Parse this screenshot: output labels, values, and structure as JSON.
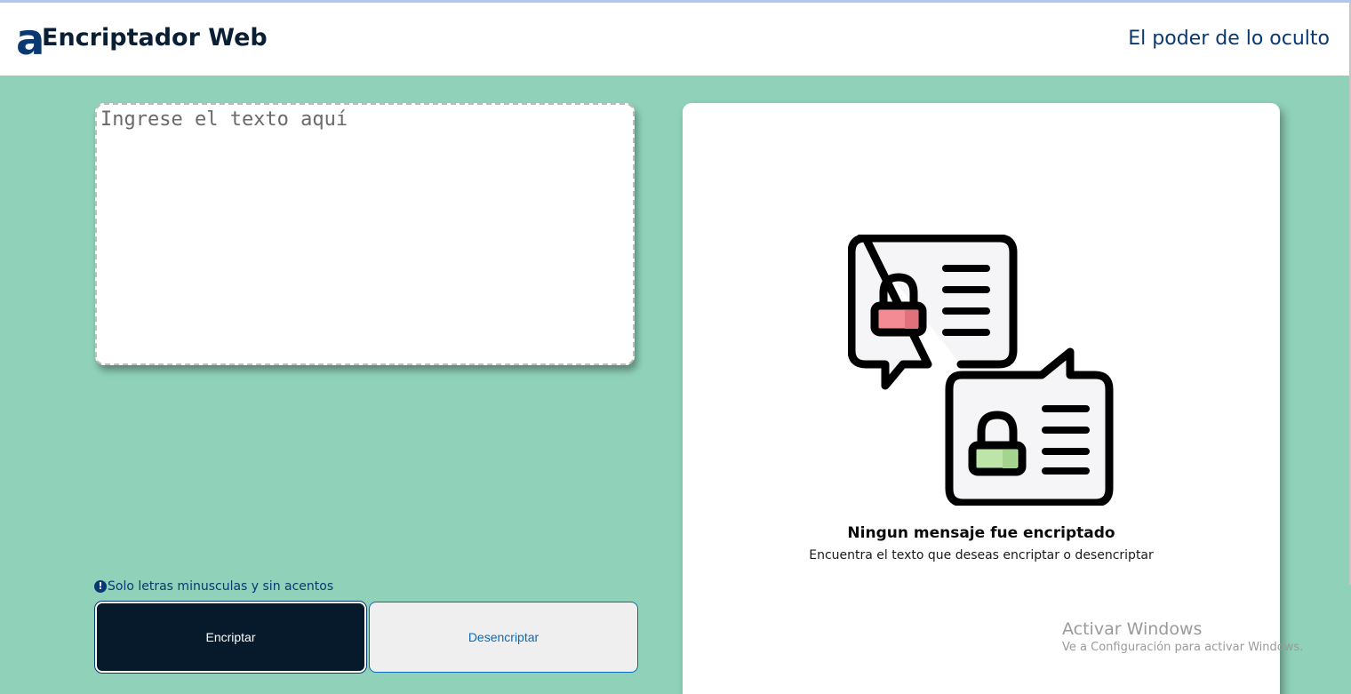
{
  "header": {
    "logo_letter": "a",
    "title": "Encriptador Web",
    "tagline": "El poder de lo oculto"
  },
  "input": {
    "placeholder": "Ingrese el texto aquí"
  },
  "hint": {
    "icon": "!",
    "text": "Solo letras minusculas y sin acentos"
  },
  "buttons": {
    "encrypt": "Encriptar",
    "decrypt": "Desencriptar"
  },
  "output": {
    "title": "Ningun mensaje fue encriptado",
    "subtitle": "Encuentra el texto que deseas encriptar o desencriptar"
  },
  "watermark": {
    "title": "Activar Windows",
    "subtitle": "Ve a Configuración para activar Windows."
  },
  "colors": {
    "background": "#8fd1b9",
    "primary": "#0a3871",
    "lock_red": "#f28b93",
    "lock_green": "#bde5a8"
  }
}
